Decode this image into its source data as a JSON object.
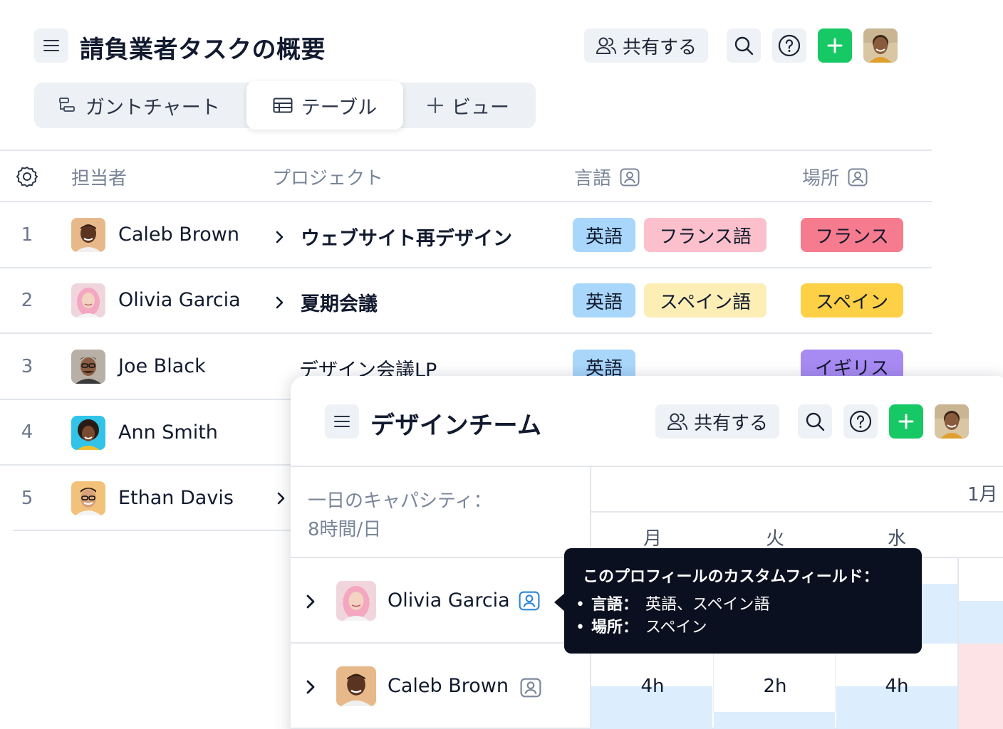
{
  "header": {
    "title": "請負業者タスクの概要",
    "share_label": "共有する"
  },
  "tabs": [
    {
      "label": "ガントチャート"
    },
    {
      "label": "テーブル"
    },
    {
      "label": "ビュー"
    }
  ],
  "table": {
    "columns": {
      "assignee": "担当者",
      "project": "プロジェクト",
      "language": "言語",
      "location": "場所"
    },
    "rows": [
      {
        "num": "1",
        "name": "Caleb Brown",
        "project": "ウェブサイト再デザイン",
        "languages": [
          "英語",
          "フランス語"
        ],
        "location": "フランス"
      },
      {
        "num": "2",
        "name": "Olivia Garcia",
        "project": "夏期会議",
        "languages": [
          "英語",
          "スペイン語"
        ],
        "location": "スペイン"
      },
      {
        "num": "3",
        "name": "Joe Black",
        "project": "デザイン会議LP",
        "languages": [
          "英語"
        ],
        "location": "イギリス"
      },
      {
        "num": "4",
        "name": "Ann Smith"
      },
      {
        "num": "5",
        "name": "Ethan Davis"
      }
    ]
  },
  "colors": {
    "lang_en": "#a9d6fb",
    "lang_fr": "#fbc0cb",
    "lang_es": "#fdeeb6",
    "loc_fr": "#f77b8e",
    "loc_es": "#fdd046",
    "loc_uk": "#a88af3",
    "add_green": "#17c964"
  },
  "panel": {
    "title": "デザインチーム",
    "share_label": "共有する",
    "capacity_line1": "一日のキャパシティ：",
    "capacity_line2": "8時間/日",
    "month": "1月",
    "days": [
      "月",
      "火",
      "水"
    ],
    "people": [
      {
        "name": "Olivia Garcia"
      },
      {
        "name": "Caleb Brown",
        "hours": [
          "4h",
          "2h",
          "4h"
        ]
      }
    ],
    "tooltip": {
      "title": "このプロフィールのカスタムフィールド：",
      "items": [
        {
          "key": "言語：",
          "value": "英語、スペイン語"
        },
        {
          "key": "場所：",
          "value": "スペイン"
        }
      ]
    }
  }
}
